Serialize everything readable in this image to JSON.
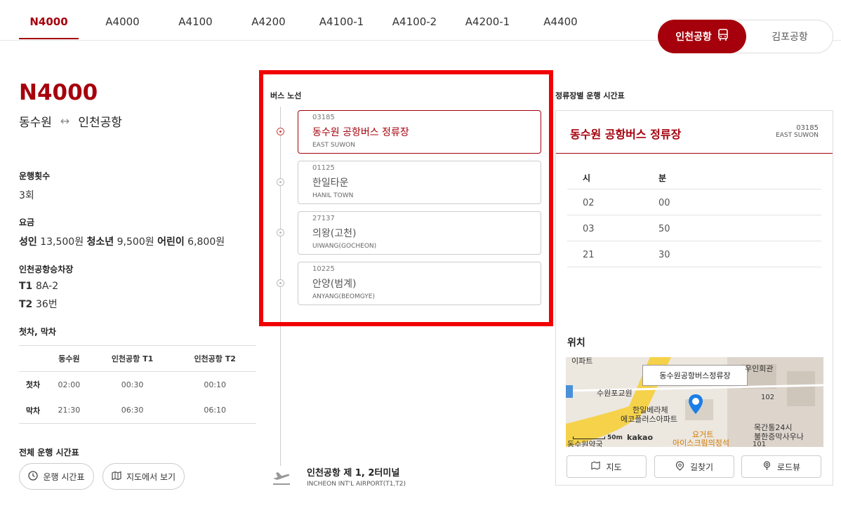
{
  "tabs": [
    "N4000",
    "A4000",
    "A4100",
    "A4200",
    "A4100-1",
    "A4100-2",
    "A4200-1",
    "A4400"
  ],
  "airport_toggle": {
    "incheon": "인천공항",
    "gimpo": "김포공항"
  },
  "route": {
    "number": "N4000",
    "from": "동수원",
    "arrow": "↔",
    "to": "인천공항"
  },
  "info": {
    "runs_label": "운행횟수",
    "runs_value": "3회",
    "fare_label": "요금",
    "fare": {
      "adult_label": "성인",
      "adult": "13,500원",
      "youth_label": "청소년",
      "youth": "9,500원",
      "child_label": "어린이",
      "child": "6,800원"
    },
    "stops_label": "인천공항승차장",
    "t1_label": "T1",
    "t1": "8A-2",
    "t2_label": "T2",
    "t2": "36번",
    "firstlast_label": "첫차, 막차",
    "table": {
      "headers": [
        "",
        "동수원",
        "인천공항 T1",
        "인천공항 T2"
      ],
      "rows": [
        {
          "label": "첫차",
          "values": [
            "02:00",
            "00:30",
            "00:10"
          ]
        },
        {
          "label": "막차",
          "values": [
            "21:30",
            "06:30",
            "06:10"
          ]
        }
      ]
    },
    "all_timetable_label": "전체 운행 시간표",
    "btn_timetable": "운행 시간표",
    "btn_map": "지도에서 보기"
  },
  "bus_route": {
    "title": "버스 노선",
    "stops": [
      {
        "id": "03185",
        "name": "동수원 공항버스 정류장",
        "en": "EAST SUWON"
      },
      {
        "id": "01125",
        "name": "한일타운",
        "en": "HANIL TOWN"
      },
      {
        "id": "27137",
        "name": "의왕(고천)",
        "en": "UIWANG(GOCHEON)"
      },
      {
        "id": "10225",
        "name": "안양(범계)",
        "en": "ANYANG(BEOMGYE)"
      }
    ],
    "terminal": {
      "name": "인천공항 제 1, 2터미널",
      "en": "INCHEON INT'L AIRPORT(T1,T2)"
    }
  },
  "stop_timetable": {
    "title": "정류장별 운행 시간표",
    "stop_name": "동수원 공항버스 정류장",
    "stop_id": "03185",
    "stop_en": "EAST SUWON",
    "col_hour": "시",
    "col_min": "분",
    "rows": [
      {
        "hour": "02",
        "min": "00"
      },
      {
        "hour": "03",
        "min": "50"
      },
      {
        "hour": "21",
        "min": "30"
      }
    ]
  },
  "location": {
    "title": "위치",
    "map_tag": "동수원공항버스정류장",
    "map_labels": [
      "수원포교원",
      "한일베라체",
      "에코플러스아파트",
      "요거트",
      "아이스크림의정석",
      "목간통24시",
      "불한증막사우나",
      "동수원약국",
      "우인회관",
      "102",
      "101",
      "이파트"
    ],
    "scale": "50m",
    "brand": "kakao",
    "btn_map": "지도",
    "btn_route": "길찾기",
    "btn_roadview": "로드뷰"
  }
}
